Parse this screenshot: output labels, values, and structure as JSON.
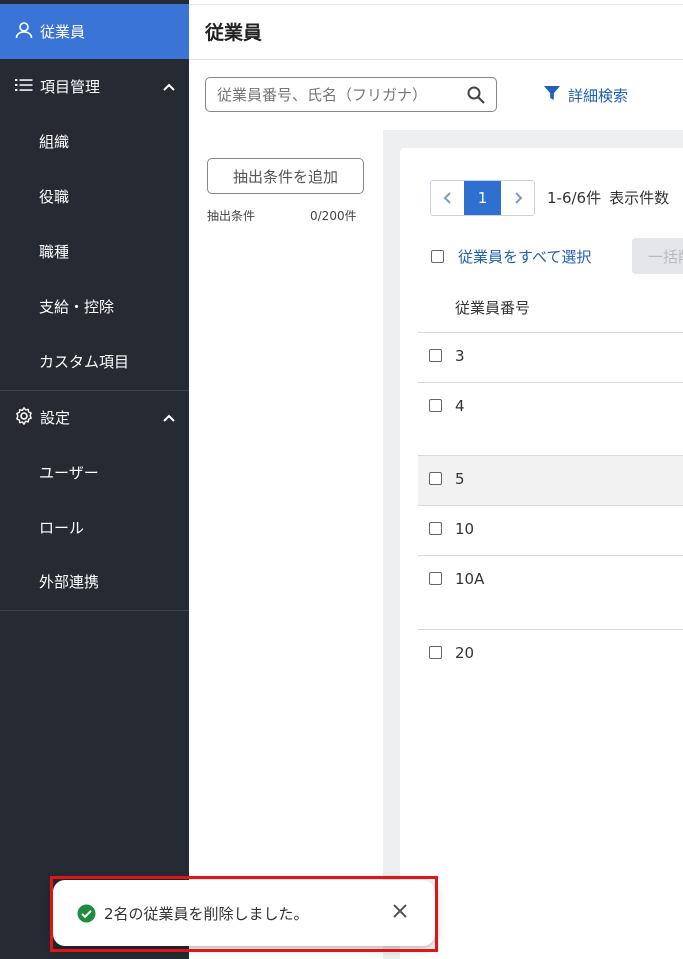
{
  "sidebar": {
    "top_item": "従業員",
    "sections": [
      {
        "label": "項目管理",
        "items": [
          "組織",
          "役職",
          "職種",
          "支給・控除",
          "カスタム項目"
        ]
      },
      {
        "label": "設定",
        "items": [
          "ユーザー",
          "ロール",
          "外部連携"
        ]
      }
    ]
  },
  "header": {
    "title": "従業員"
  },
  "search": {
    "placeholder": "従業員番号、氏名（フリガナ）",
    "advanced_label": "詳細検索"
  },
  "filters": {
    "add_button": "抽出条件を追加",
    "label": "抽出条件",
    "count": "0/200件"
  },
  "pager": {
    "current_page": "1",
    "range": "1-6/6件",
    "per_page_label": "表示件数"
  },
  "list": {
    "select_all_label": "従業員をすべて選択",
    "bulk_button": "一括削",
    "column_header": "従業員番号",
    "rows": [
      "3",
      "4",
      "5",
      "10",
      "10A",
      "20"
    ]
  },
  "toast": {
    "message": "2名の従業員を削除しました。"
  },
  "colors": {
    "sidebar_bg": "#252a33",
    "sidebar_active": "#3a74d6",
    "link": "#1f5fb8",
    "success": "#1e8e3e",
    "highlight_border": "#e01616"
  }
}
